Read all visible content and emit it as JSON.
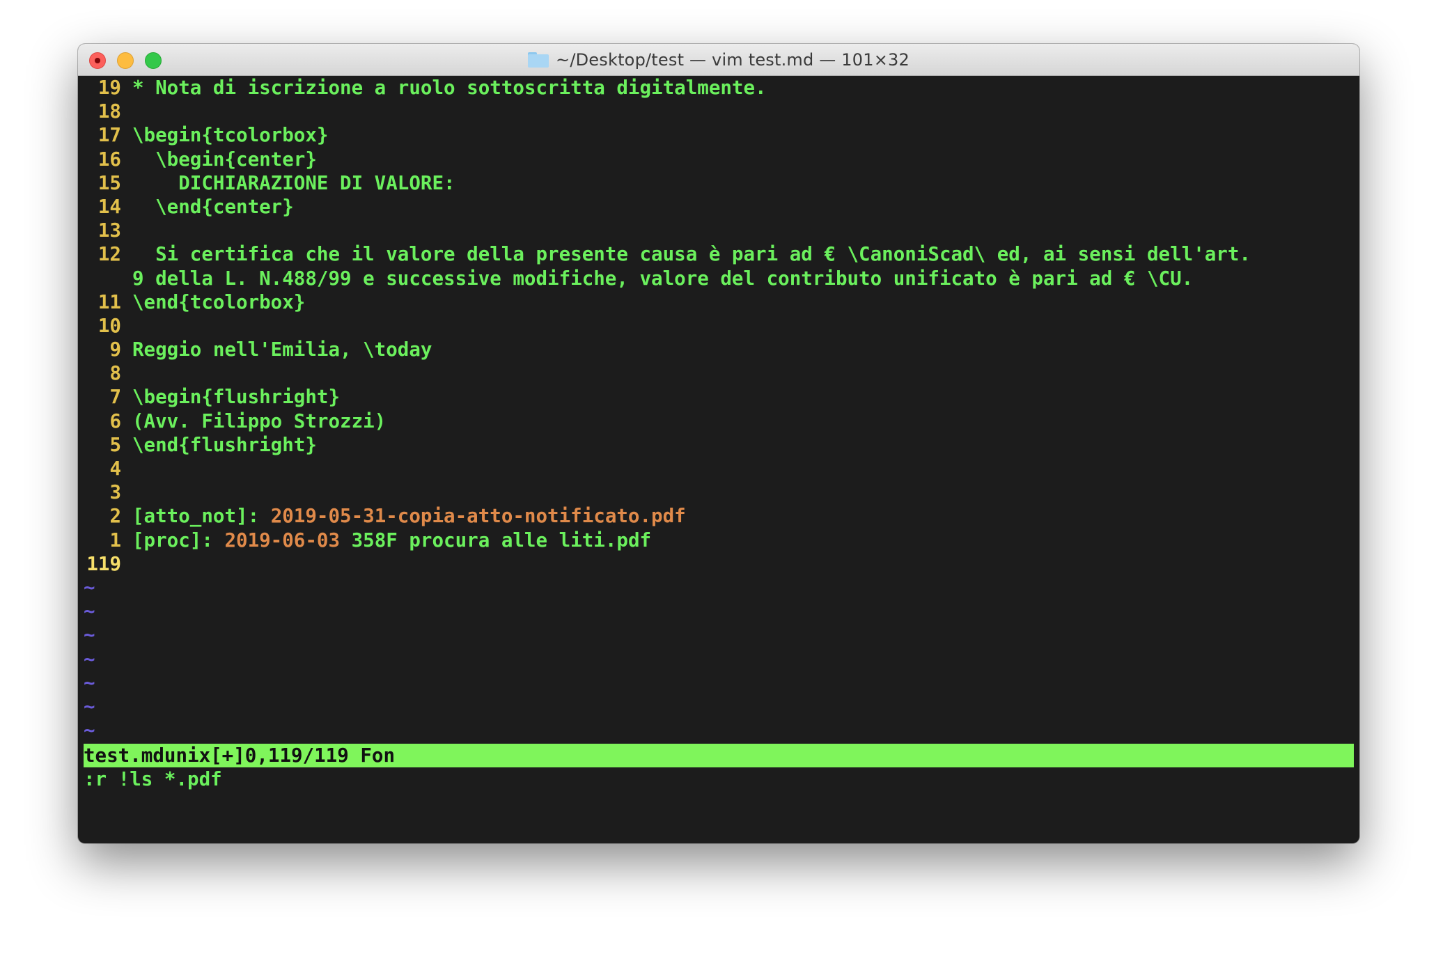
{
  "window": {
    "title": "~/Desktop/test — vim test.md — 101×32"
  },
  "lines": [
    {
      "num": "19",
      "text": "* Nota di iscrizione a ruolo sottoscritta digitalmente."
    },
    {
      "num": "18",
      "text": ""
    },
    {
      "num": "17",
      "text": "\\begin{tcolorbox}"
    },
    {
      "num": "16",
      "text": "  \\begin{center}"
    },
    {
      "num": "15",
      "text": "    DICHIARAZIONE DI VALORE:"
    },
    {
      "num": "14",
      "text": "  \\end{center}"
    },
    {
      "num": "13",
      "text": ""
    },
    {
      "num": "12",
      "text": "  Si certifica che il valore della presente causa è pari ad € \\CanoniScad\\ ed, ai sensi dell'art."
    },
    {
      "num": "",
      "text": "9 della L. N.488/99 e successive modifiche, valore del contributo unificato è pari ad € \\CU."
    },
    {
      "num": "11",
      "text": "\\end{tcolorbox}"
    },
    {
      "num": "10",
      "text": ""
    },
    {
      "num": "9",
      "text": "Reggio nell'Emilia, \\today"
    },
    {
      "num": "8",
      "text": ""
    },
    {
      "num": "7",
      "text": "\\begin{flushright}"
    },
    {
      "num": "6",
      "text": "(Avv. Filippo Strozzi)"
    },
    {
      "num": "5",
      "text": "\\end{flushright}"
    },
    {
      "num": "4",
      "text": ""
    },
    {
      "num": "3",
      "text": ""
    }
  ],
  "ref_lines": [
    {
      "num": "2",
      "prefix": "[atto_not]: ",
      "orange": "2019-05-31-copia-atto-notificato.pdf",
      "rest": ""
    },
    {
      "num": "1",
      "prefix": "[proc]: ",
      "orange": "2019-06-03",
      "rest": " 358F procura alle liti.pdf"
    }
  ],
  "current_line": {
    "num": "119",
    "text": ""
  },
  "tildes": [
    "~",
    "~",
    "~",
    "~",
    "~",
    "~",
    "~"
  ],
  "statusline": "test.mdunix[+]0,119/119 Fon",
  "cmdline": ":r !ls *.pdf"
}
